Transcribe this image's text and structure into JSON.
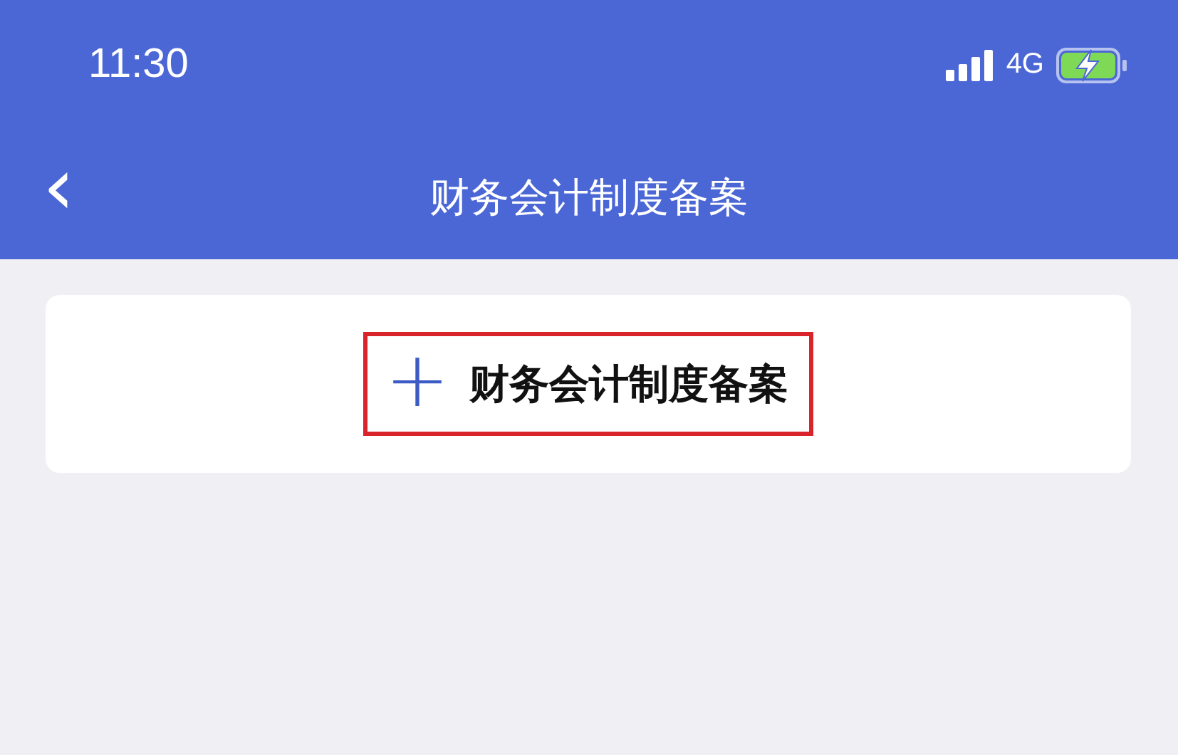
{
  "status_bar": {
    "time": "11:30",
    "network": "4G",
    "charging": true
  },
  "nav_bar": {
    "back_icon": "‹",
    "title": "财务会计制度备案"
  },
  "card": {
    "add_button": {
      "icon": "+",
      "label": "财务会计制度备案",
      "highlighted": true
    }
  }
}
